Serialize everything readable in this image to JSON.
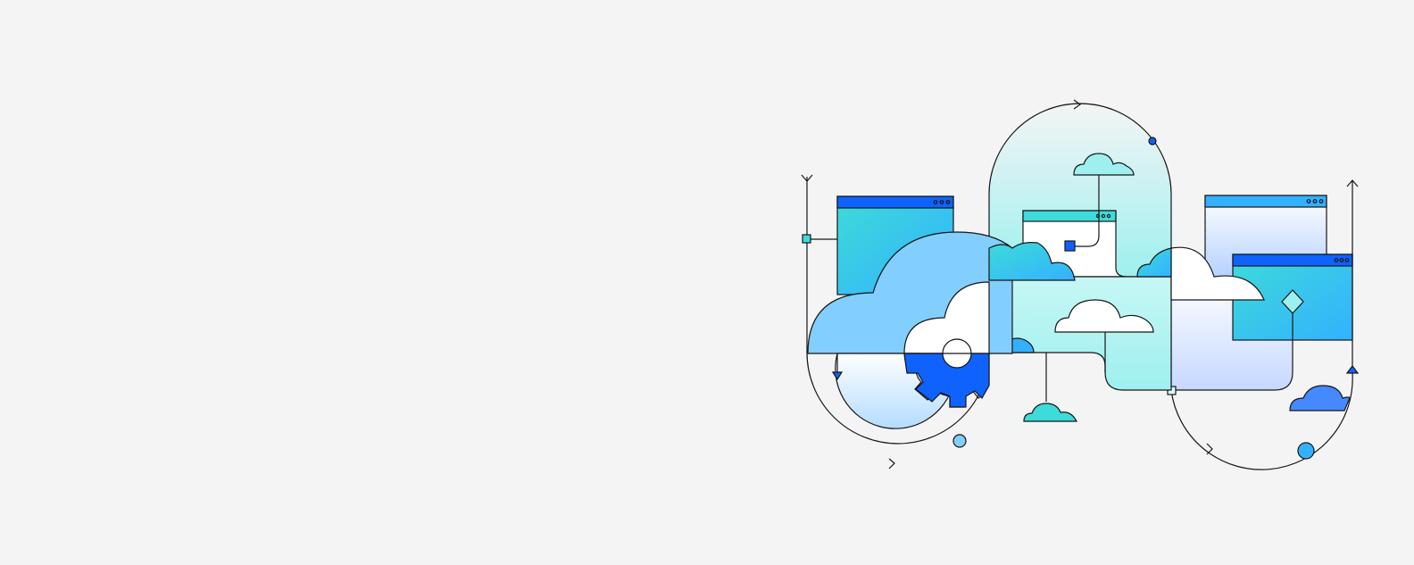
{
  "banner": {
    "colors": {
      "background": "#f4f4f4",
      "stroke": "#161616",
      "blue": "#0f62fe",
      "bright_blue": "#0072ff",
      "sky": "#33b1ff",
      "light_sky": "#82cfff",
      "cloud_blue": "#4589ff",
      "teal": "#3ddbd9",
      "mint": "#9ef0f0",
      "pale_mint": "#d9fbfb",
      "lavender": "#d0e2ff",
      "white": "#ffffff"
    },
    "icons": [
      "cloud-icon",
      "browser-window-icon",
      "gear-icon",
      "flow-arrow-icon",
      "connector-node-icon",
      "diamond-decision-icon"
    ]
  }
}
